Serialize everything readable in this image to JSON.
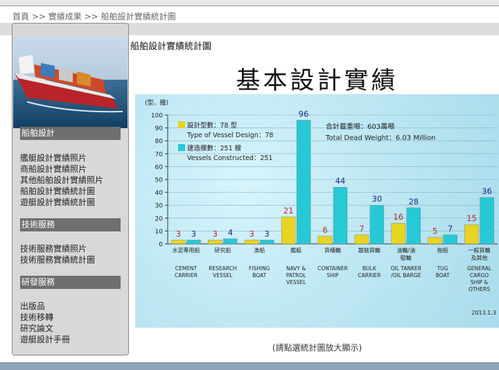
{
  "breadcrumb": {
    "home": "首頁",
    "sep": ">>",
    "item1": "實績成果",
    "item2": "船舶設計實績統計圖"
  },
  "sidebar": {
    "sections": [
      {
        "title": "船舶設計",
        "links": [
          "艦艇設計實績照片",
          "商船設計實績照片",
          "其他船舶設計實績照片",
          "船舶設計實績統計圖",
          "遊艇設計實績統計圖"
        ]
      },
      {
        "title": "技術服務",
        "links": [
          "技術服務實績照片",
          "技術服務實績統計圖"
        ]
      },
      {
        "title": "研發服務",
        "links": [
          "出版品",
          "技術移轉",
          "研究論文",
          "遊艇設計手冊"
        ]
      }
    ]
  },
  "page_title": "船舶設計實績統計圖",
  "big_title": "基本設計實績",
  "caption": "(請點選統計圖放大顯示)",
  "colors": {
    "design": "#e8d422",
    "constructed": "#27c9d6",
    "value_label": "#b52a2a",
    "value_label_2": "#1a2a8a"
  },
  "chart_data": {
    "type": "bar",
    "y_unit_label": "(型、艘)",
    "ylim": [
      0,
      100
    ],
    "yticks": [
      0,
      10,
      20,
      30,
      40,
      50,
      60,
      70,
      80,
      90,
      100
    ],
    "categories_zh": [
      "水泥專用船",
      "研究船",
      "漁船",
      "艦艇",
      "貨櫃輪",
      "散裝貨輪",
      "油輪/油駁輪",
      "拖船",
      "一般貨輪及其他"
    ],
    "categories_en": [
      [
        "CEMENT",
        "CARRIER"
      ],
      [
        "RESEARCH",
        "VESSEL"
      ],
      [
        "FISHING",
        "BOAT"
      ],
      [
        "NAVY &",
        "PATROL",
        "VESSEL"
      ],
      [
        "CONTAINER",
        "SHIP"
      ],
      [
        "BULK",
        "CARRIER"
      ],
      [
        "OIL TANKER",
        "/OIL BARGE"
      ],
      [
        "TUG",
        "BOAT"
      ],
      [
        "GENERAL",
        "CARGO",
        "SHIP &",
        "OTHERS"
      ]
    ],
    "series": [
      {
        "name": "設計型數：78 型",
        "values": [
          3,
          3,
          3,
          21,
          6,
          7,
          16,
          5,
          15
        ]
      },
      {
        "name": "建造艘數：251 艘",
        "values": [
          3,
          4,
          3,
          96,
          44,
          30,
          28,
          7,
          36
        ]
      }
    ],
    "legend": {
      "design_zh": "設計型數：78 型",
      "design_en": "Type of Vessel Design：78",
      "built_zh": "建造艘數：251 艘",
      "built_en": "Vessels Constructed：251"
    },
    "total_zh": "合計載重噸：603萬噸",
    "total_en": "Total Dead Weight：6.03 Million",
    "date": "2013.1.3"
  }
}
